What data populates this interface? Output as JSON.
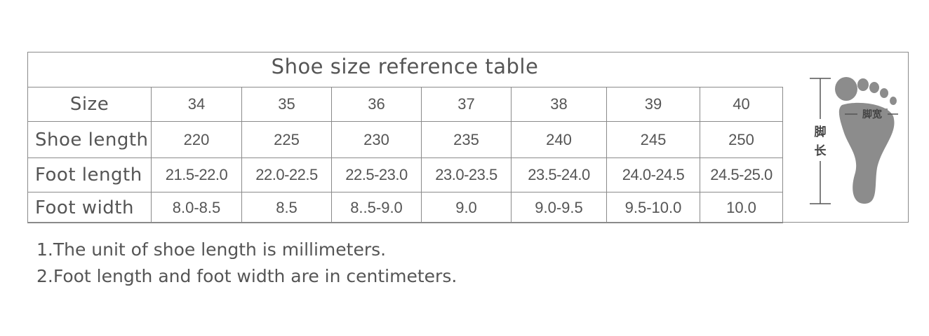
{
  "table": {
    "title": "Shoe size reference table",
    "rows": [
      {
        "label": "Size",
        "values": [
          "34",
          "35",
          "36",
          "37",
          "38",
          "39",
          "40"
        ]
      },
      {
        "label": "Shoe length",
        "values": [
          "220",
          "225",
          "230",
          "235",
          "240",
          "245",
          "250"
        ]
      },
      {
        "label": "Foot length",
        "values": [
          "21.5-22.0",
          "22.0-22.5",
          "22.5-23.0",
          "23.0-23.5",
          "23.5-24.0",
          "24.0-24.5",
          "24.5-25.0"
        ]
      },
      {
        "label": "Foot width",
        "values": [
          "8.0-8.5",
          "8.5",
          "8..5-9.0",
          "9.0",
          "9.0-9.5",
          "9.5-10.0",
          "10.0"
        ]
      }
    ]
  },
  "diagram": {
    "width_label": "脚宽",
    "length_label_1": "脚",
    "length_label_2": "长",
    "foot_color": "#8c8c8c",
    "line_color": "#555555"
  },
  "notes": [
    "1.The unit of shoe length is millimeters.",
    "2.Foot length and foot width are in centimeters."
  ]
}
